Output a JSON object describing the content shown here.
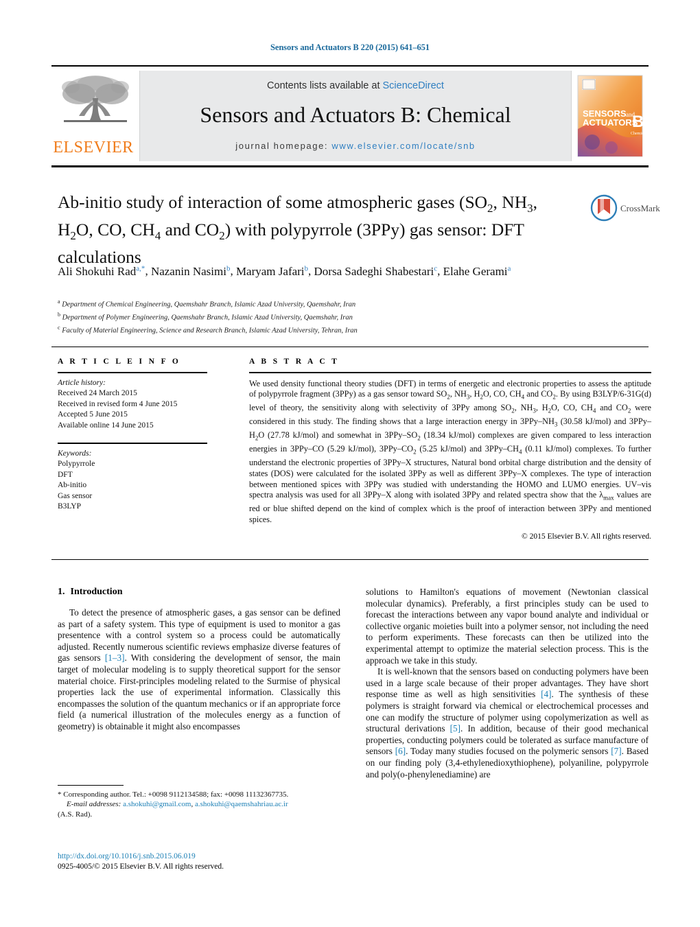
{
  "running_head": "Sensors and Actuators B 220 (2015) 641–651",
  "masthead": {
    "contents_prefix": "Contents lists available at",
    "sciencedirect": "ScienceDirect",
    "journal_title": "Sensors and Actuators B: Chemical",
    "homepage_prefix": "journal homepage:",
    "homepage_url": "www.elsevier.com/locate/snb",
    "publisher_wordmark": "ELSEVIER",
    "publisher_color": "#f07c1b",
    "link_color": "#2f7fc1",
    "cover_line1": "SENSORS",
    "cover_and": "and",
    "cover_line2": "ACTUATORS",
    "cover_letter": "B",
    "cover_sub": "Chemical"
  },
  "article": {
    "title_part1": "Ab-initio study of interaction of some atmospheric gases (SO",
    "title_sub1": "2",
    "title_part2": ", NH",
    "title_sub2": "3",
    "title_part3": ", H",
    "title_sub3": "2",
    "title_part4": "O, CO, CH",
    "title_sub4": "4",
    "title_part5": " and CO",
    "title_sub5": "2",
    "title_part6": ") with polypyrrole (3PPy) gas sensor: DFT calculations",
    "crossmark_label": "CrossMark",
    "authors": [
      {
        "name": "Ali Shokuhi Rad",
        "marks": "a,*"
      },
      {
        "name": "Nazanin Nasimi",
        "marks": "b"
      },
      {
        "name": "Maryam Jafari",
        "marks": "b"
      },
      {
        "name": "Dorsa Sadeghi Shabestari",
        "marks": "c"
      },
      {
        "name": "Elahe Gerami",
        "marks": "a"
      }
    ],
    "affiliations": [
      {
        "mark": "a",
        "text": "Department of Chemical Engineering, Qaemshahr Branch, Islamic Azad University, Qaemshahr, Iran"
      },
      {
        "mark": "b",
        "text": "Department of Polymer Engineering, Qaemshahr Branch, Islamic Azad University, Qaemshahr, Iran"
      },
      {
        "mark": "c",
        "text": "Faculty of Material Engineering, Science and Research Branch, Islamic Azad University, Tehran, Iran"
      }
    ]
  },
  "article_info": {
    "heading": "A R T I C L E  I N F O",
    "history_label": "Article history:",
    "history": [
      "Received 24 March 2015",
      "Received in revised form 4 June 2015",
      "Accepted 5 June 2015",
      "Available online 14 June 2015"
    ],
    "keywords_label": "Keywords:",
    "keywords": [
      "Polypyrrole",
      "DFT",
      "Ab-initio",
      "Gas sensor",
      "B3LYP"
    ]
  },
  "abstract": {
    "heading": "A B S T R A C T",
    "copyright": "© 2015 Elsevier B.V. All rights reserved.",
    "segments": [
      {
        "t": "We used density functional theory studies (DFT) in terms of energetic and electronic properties to assess the aptitude of polypyrrole fragment (3PPy) as a gas sensor toward SO"
      },
      {
        "sub": "2"
      },
      {
        "t": ", NH"
      },
      {
        "sub": "3"
      },
      {
        "t": ", H"
      },
      {
        "sub": "2"
      },
      {
        "t": "O, CO, CH"
      },
      {
        "sub": "4"
      },
      {
        "t": " and CO"
      },
      {
        "sub": "2"
      },
      {
        "t": ". By using B3LYP/6-31G(d) level of theory, the sensitivity along with selectivity of 3PPy among SO"
      },
      {
        "sub": "2"
      },
      {
        "t": ", NH"
      },
      {
        "sub": "3"
      },
      {
        "t": ", H"
      },
      {
        "sub": "2"
      },
      {
        "t": "O, CO, CH"
      },
      {
        "sub": "4"
      },
      {
        "t": " and CO"
      },
      {
        "sub": "2"
      },
      {
        "t": " were considered in this study. The finding shows that a large interaction energy in 3PPy–NH"
      },
      {
        "sub": "3"
      },
      {
        "t": " (30.58 kJ/mol) and 3PPy–H"
      },
      {
        "sub": "2"
      },
      {
        "t": "O (27.78 kJ/mol) and somewhat in 3PPy–SO"
      },
      {
        "sub": "2"
      },
      {
        "t": " (18.34 kJ/mol) complexes are given compared to less interaction energies in 3PPy–CO (5.29 kJ/mol), 3PPy–CO"
      },
      {
        "sub": "2"
      },
      {
        "t": " (5.25 kJ/mol) and 3PPy–CH"
      },
      {
        "sub": "4"
      },
      {
        "t": " (0.11 kJ/mol) complexes. To further understand the electronic properties of 3PPy–X structures, Natural bond orbital charge distribution and the density of states (DOS) were calculated for the isolated 3PPy as well as different 3PPy–X complexes. The type of interaction between mentioned spices with 3PPy was studied with understanding the HOMO and LUMO energies. UV–vis spectra analysis was used for all 3PPy–X along with isolated 3PPy and related spectra show that the λ"
      },
      {
        "sub": "max"
      },
      {
        "t": " values are red or blue shifted depend on the kind of complex which is the proof of interaction between 3PPy and mentioned spices."
      }
    ]
  },
  "body": {
    "section_number": "1.",
    "section_title": "Introduction",
    "left_paragraphs": [
      {
        "segments": [
          {
            "t": "To detect the presence of atmospheric gases, a gas sensor can be defined as part of a safety system. This type of equipment is used to monitor a gas presentence with a control system so a process could be automatically adjusted. Recently numerous scientific reviews emphasize diverse features of gas sensors "
          },
          {
            "ref": "[1–3]"
          },
          {
            "t": ". With considering the development of sensor, the main target of molecular modeling is to supply theoretical support for the sensor material choice. First-principles modeling related to the Surmise of physical properties lack the use of experimental information. Classically this encompasses the solution of the quantum mechanics or if an appropriate force field (a numerical illustration of the molecules energy as a function of geometry) is obtainable it might also encompasses"
          }
        ]
      }
    ],
    "right_paragraphs": [
      {
        "indent": false,
        "segments": [
          {
            "t": "solutions to Hamilton's equations of movement (Newtonian classical molecular dynamics). Preferably, a first principles study can be used to forecast the interactions between any vapor bound analyte and individual or collective organic moieties built into a polymer sensor, not including the need to perform experiments. These forecasts can then be utilized into the experimental attempt to optimize the material selection process. This is the approach we take in this study."
          }
        ]
      },
      {
        "indent": true,
        "segments": [
          {
            "t": "It is well-known that the sensors based on conducting polymers have been used in a large scale because of their proper advantages. They have short response time as well as high sensitivities "
          },
          {
            "ref": "[4]"
          },
          {
            "t": ". The synthesis of these polymers is straight forward via chemical or electrochemical processes and one can modify the structure of polymer using copolymerization as well as structural derivations "
          },
          {
            "ref": "[5]"
          },
          {
            "t": ". In addition, because of their good mechanical properties, conducting polymers could be tolerated as surface manufacture of sensors "
          },
          {
            "ref": "[6]"
          },
          {
            "t": ". Today many studies focused on the polymeric sensors "
          },
          {
            "ref": "[7]"
          },
          {
            "t": ". Based on our finding poly (3,4-ethylenedioxythiophene), polyaniline, polypyrrole and poly(o-phenylenediamine) are"
          }
        ]
      }
    ]
  },
  "footnotes": {
    "corresponding_marker": "*",
    "corresponding_text": "Corresponding author. Tel.: +0098 9112134588; fax: +0098 11132367735.",
    "email_label": "E-mail addresses:",
    "email_1": "a.shokuhi@gmail.com",
    "email_sep": ",",
    "email_2": "a.shokuhi@qaemshahriau.ac.ir",
    "email_owner": "(A.S. Rad).",
    "doi_url": "http://dx.doi.org/10.1016/j.snb.2015.06.019",
    "issn_line": "0925-4005/© 2015 Elsevier B.V. All rights reserved."
  }
}
